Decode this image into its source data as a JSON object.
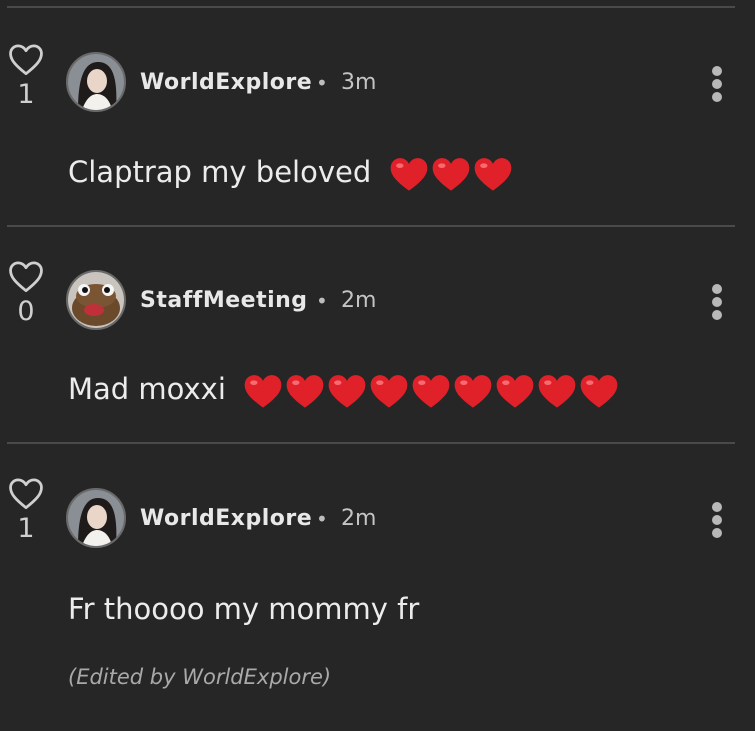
{
  "comments": [
    {
      "username": "WorldExplore",
      "time": "3m",
      "likes": "1",
      "text": "Claptrap my beloved",
      "red_hearts": 3,
      "avatar": "avatar-woman"
    },
    {
      "username": "StaffMeeting",
      "time": "2m",
      "likes": "0",
      "text": "Mad moxxi",
      "red_hearts": 9,
      "avatar": "avatar-frog"
    },
    {
      "username": "WorldExplore",
      "time": "2m",
      "likes": "1",
      "text": "Fr thoooo my mommy fr",
      "red_hearts": 0,
      "edited_note": "(Edited by WorldExplore)",
      "avatar": "avatar-woman"
    }
  ],
  "separator": "•",
  "colors": {
    "background": "#262626",
    "divider": "#4a4a4a",
    "heart_red": "#e0212a"
  },
  "icons": {
    "like": "heart-outline-icon",
    "menu": "more-vertical-icon",
    "emoji": "red-heart-emoji"
  }
}
